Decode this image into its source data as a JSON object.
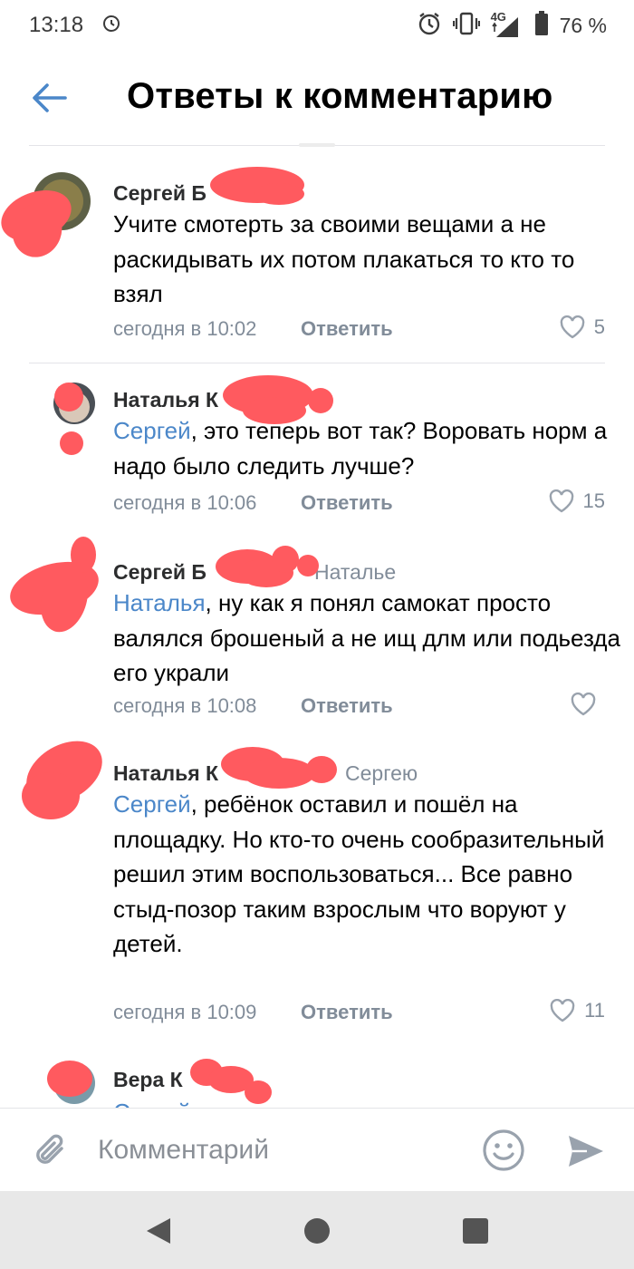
{
  "status_bar": {
    "time": "13:18",
    "network": "4G",
    "battery": "76 %"
  },
  "header": {
    "title": "Ответы к комментарию"
  },
  "comments": [
    {
      "author": "Сергей Б",
      "reply_to": "",
      "mention": "",
      "text": "Учите смотерть за своими вещами а не раскидывать их потом плакаться то кто то взял",
      "time": "сегодня в 10:02",
      "reply_label": "Ответить",
      "likes": "5"
    },
    {
      "author": "Наталья К",
      "reply_to": "",
      "mention": "Сергей",
      "text": ", это теперь вот так? Воровать норм а надо было следить лучше?",
      "time": "сегодня в 10:06",
      "reply_label": "Ответить",
      "likes": "15"
    },
    {
      "author": "Сергей Б",
      "reply_to": "Наталье",
      "mention": "Наталья",
      "text": ", ну как я понял самокат просто валялся брошеный а не ищ длм или подьезда его украли",
      "time": "сегодня в 10:08",
      "reply_label": "Ответить",
      "likes": ""
    },
    {
      "author": "Наталья К",
      "reply_to": "Сергею",
      "mention": "Сергей",
      "text": ", ребёнок оставил и пошёл на площадку. Но кто-то очень сообразительный решил этим воспользоваться... Все равно стыд-позор таким взрослым что воруют у детей.",
      "time": "сегодня в 10:09",
      "reply_label": "Ответить",
      "likes": "11"
    },
    {
      "author": "Вера К",
      "reply_to": "",
      "mention": "Сергей",
      "text": ", вс...",
      "time": "",
      "reply_label": "",
      "likes": ""
    }
  ],
  "composer": {
    "placeholder": "Комментарий"
  },
  "icons": {
    "back": "arrow-left-icon",
    "attach": "paperclip-icon",
    "emoji": "smile-icon",
    "send": "send-icon",
    "like": "heart-outline-icon"
  },
  "colors": {
    "accent": "#4b87c9",
    "meta": "#818c99",
    "redaction": "#ff5a5f"
  }
}
